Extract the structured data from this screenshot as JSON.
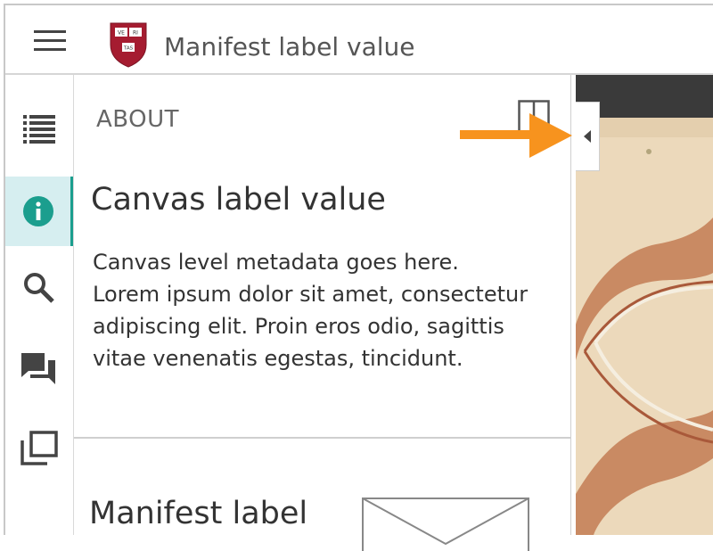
{
  "header": {
    "title": "Manifest label value",
    "shield_text": [
      "VE",
      "RI",
      "TAS"
    ]
  },
  "leftrail": {
    "items": [
      {
        "name": "contents"
      },
      {
        "name": "info"
      },
      {
        "name": "search"
      },
      {
        "name": "annotations"
      },
      {
        "name": "gallery"
      }
    ],
    "active_index": 1,
    "accent_color": "#1b9e8e"
  },
  "panel": {
    "heading": "ABOUT",
    "canvas": {
      "label": "Canvas label value",
      "description": "Canvas level metadata goes here. Lorem ipsum dolor sit amet, consectetur adipiscing elit. Proin eros odio, sagittis vitae venenatis egestas, tincidunt."
    },
    "manifest": {
      "label": "Manifest label"
    }
  },
  "colors": {
    "arrow": "#f7931e",
    "shield": "#a51c30"
  }
}
